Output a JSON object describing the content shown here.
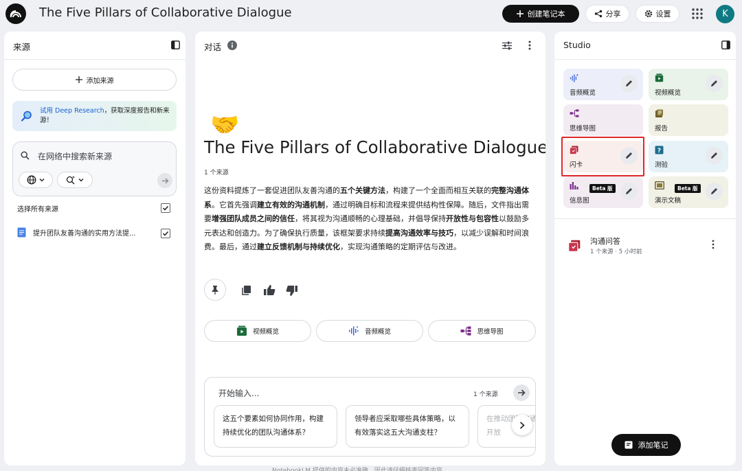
{
  "header": {
    "title": "The Five Pillars of Collaborative Dialogue",
    "create_label": "创建笔记本",
    "share_label": "分享",
    "settings_label": "设置",
    "avatar_initial": "K"
  },
  "sources": {
    "title": "来源",
    "add_label": "添加来源",
    "deep_research_link": "试用 Deep Research",
    "deep_research_text": "，获取深度报告和新来源！",
    "search_placeholder": "在网络中搜索新来源",
    "select_all_label": "选择所有来源",
    "select_all_checked": true,
    "items": [
      {
        "title": "提升团队友善沟通的实用方法提...",
        "checked": true
      }
    ]
  },
  "chat": {
    "title": "对话",
    "emoji": "🤝",
    "notebook_title": "The Five Pillars of Collaborative Dialogue",
    "source_count": "1 个来源",
    "summary": [
      {
        "t": "这份资料提炼了一套促进团队友善沟通的"
      },
      {
        "t": "五个关键方法",
        "b": true
      },
      {
        "t": "，构建了一个全面而相互关联的"
      },
      {
        "t": "完整沟通体系",
        "b": true
      },
      {
        "t": "。它首先强调"
      },
      {
        "t": "建立有效的沟通机制",
        "b": true
      },
      {
        "t": "，通过明确目标和流程来提供结构性保障。随后，文件指出需要"
      },
      {
        "t": "增强团队成员之间的信任",
        "b": true
      },
      {
        "t": "，将其视为沟通顺畅的心理基础，并倡导保持"
      },
      {
        "t": "开放性与包容性",
        "b": true
      },
      {
        "t": "以鼓励多元表达和创造力。为了确保执行质量，该框架要求持续"
      },
      {
        "t": "提高沟通效率与技巧",
        "b": true
      },
      {
        "t": "，以减少误解和时间浪费。最后，通过"
      },
      {
        "t": "建立反馈机制与持续优化",
        "b": true
      },
      {
        "t": "，实现沟通策略的定期评估与改进。"
      }
    ],
    "overview_buttons": {
      "video": "视频概览",
      "audio": "音频概览",
      "mindmap": "思维导图"
    },
    "input_placeholder": "开始输入...",
    "input_source_count": "1 个来源",
    "suggestions": [
      "这五个要素如何协同作用，构建持续优化的团队沟通体系？",
      "领导者应采取哪些具体策略，以有效落实这五大沟通支柱？",
      "在推动团队沟通时，如何平衡和开放"
    ],
    "footer_note": "NotebookLM 提供的内容未必准确，因此请仔细核查回答内容。"
  },
  "studio": {
    "title": "Studio",
    "tiles": {
      "audio": "音频概览",
      "video": "视频概览",
      "mindmap": "思维导图",
      "report": "报告",
      "flashcards": "闪卡",
      "quiz": "测验",
      "infographic": "信息图",
      "slides": "演示文稿"
    },
    "beta_label": "Beta 版",
    "notes": [
      {
        "title": "沟通问答",
        "meta": "1 个来源 · 5 小时前"
      }
    ],
    "add_note_label": "添加笔记"
  },
  "colors": {
    "accent_link": "#1a5fd0",
    "highlight_box": "#e0262a",
    "tile_audio": "#eceff9",
    "tile_video": "#e9f3ea",
    "tile_mindmap": "#f2ebf2",
    "tile_report": "#f1f1e6",
    "tile_flashcards": "#f9eeec",
    "tile_quiz": "#e6f2f8",
    "tile_infographic": "#f2ebf2",
    "tile_slides": "#f1f1e6"
  }
}
